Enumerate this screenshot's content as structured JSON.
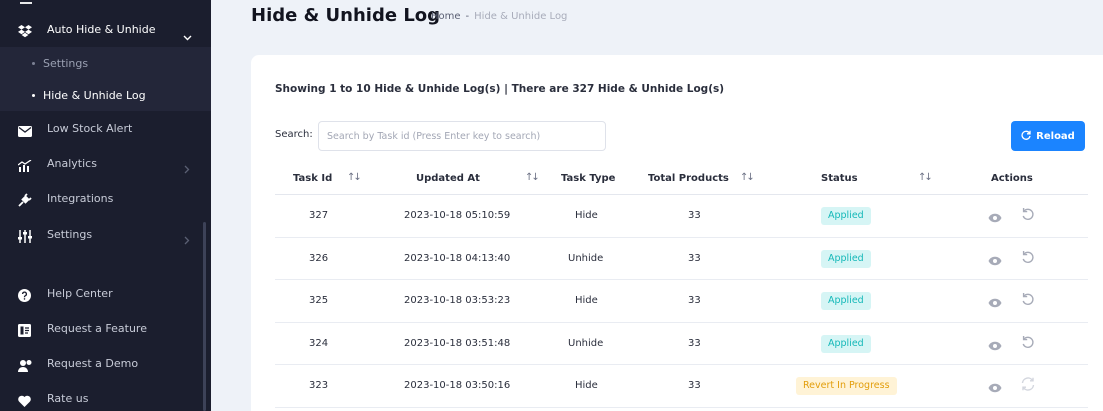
{
  "sidebar": {
    "group": {
      "label": "Auto Hide & Unhide",
      "icon": "dropbox-icon"
    },
    "sub_items": [
      {
        "label": "Settings",
        "active": false
      },
      {
        "label": "Hide & Unhide Log",
        "active": true
      }
    ],
    "items": [
      {
        "label": "Low Stock Alert",
        "icon": "envelope-icon",
        "chevron": false
      },
      {
        "label": "Analytics",
        "icon": "chart-icon",
        "chevron": true
      },
      {
        "label": "Integrations",
        "icon": "plug-icon",
        "chevron": false
      },
      {
        "label": "Settings",
        "icon": "sliders-icon",
        "chevron": true
      },
      {
        "label": "Help Center",
        "icon": "question-icon",
        "chevron": false
      },
      {
        "label": "Request a Feature",
        "icon": "feature-icon",
        "chevron": false
      },
      {
        "label": "Request a Demo",
        "icon": "demo-user-icon",
        "chevron": false
      },
      {
        "label": "Rate us",
        "icon": "heart-icon",
        "chevron": false
      }
    ]
  },
  "header": {
    "title": "Hide & Unhide Log",
    "breadcrumb": {
      "home": "Home",
      "separator": "-",
      "current": "Hide & Unhide Log"
    }
  },
  "summary": "Showing 1 to 10 Hide & Unhide Log(s) | There are 327 Hide & Unhide Log(s)",
  "search": {
    "label": "Search:",
    "placeholder": "Search by Task id (Press Enter key to search)",
    "value": ""
  },
  "reload": {
    "label": "Reload"
  },
  "table": {
    "columns": [
      "Task Id",
      "Updated At",
      "Task Type",
      "Total Products",
      "Status",
      "Actions"
    ],
    "rows": [
      {
        "task_id": "327",
        "updated_at": "2023-10-18 05:10:59",
        "task_type": "Hide",
        "total_products": "33",
        "status": "Applied"
      },
      {
        "task_id": "326",
        "updated_at": "2023-10-18 04:13:40",
        "task_type": "Unhide",
        "total_products": "33",
        "status": "Applied"
      },
      {
        "task_id": "325",
        "updated_at": "2023-10-18 03:53:23",
        "task_type": "Hide",
        "total_products": "33",
        "status": "Applied"
      },
      {
        "task_id": "324",
        "updated_at": "2023-10-18 03:51:48",
        "task_type": "Unhide",
        "total_products": "33",
        "status": "Applied"
      },
      {
        "task_id": "323",
        "updated_at": "2023-10-18 03:50:16",
        "task_type": "Hide",
        "total_products": "33",
        "status": "Revert In Progress"
      }
    ]
  },
  "colors": {
    "sidebar_bg": "#1b1e2e",
    "accent": "#1b84ff",
    "applied_text": "#14b8b8",
    "applied_bg": "#d6f5f5",
    "revert_text": "#e29e0c",
    "revert_bg": "#fff3d6"
  }
}
